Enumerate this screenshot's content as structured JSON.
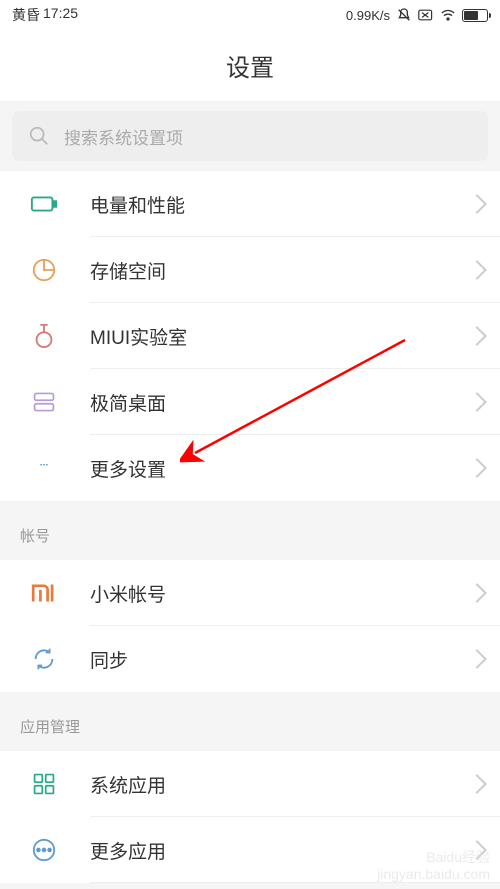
{
  "status_bar": {
    "time_prefix": "黄昏",
    "time": "17:25",
    "data_rate": "0.99K/s"
  },
  "header": {
    "title": "设置"
  },
  "search": {
    "placeholder": "搜索系统设置项"
  },
  "sections": {
    "group1": {
      "items": [
        {
          "label": "电量和性能",
          "icon": "battery-perf"
        },
        {
          "label": "存储空间",
          "icon": "storage"
        },
        {
          "label": "MIUI实验室",
          "icon": "lab"
        },
        {
          "label": "极简桌面",
          "icon": "launcher"
        },
        {
          "label": "更多设置",
          "icon": "more"
        }
      ]
    },
    "group2": {
      "header": "帐号",
      "items": [
        {
          "label": "小米帐号",
          "icon": "mi"
        },
        {
          "label": "同步",
          "icon": "sync"
        }
      ]
    },
    "group3": {
      "header": "应用管理",
      "items": [
        {
          "label": "系统应用",
          "icon": "apps"
        },
        {
          "label": "更多应用",
          "icon": "more-apps"
        }
      ]
    }
  },
  "watermark": {
    "line1": "Baidu经验",
    "line2": "jingyan.baidu.com"
  }
}
